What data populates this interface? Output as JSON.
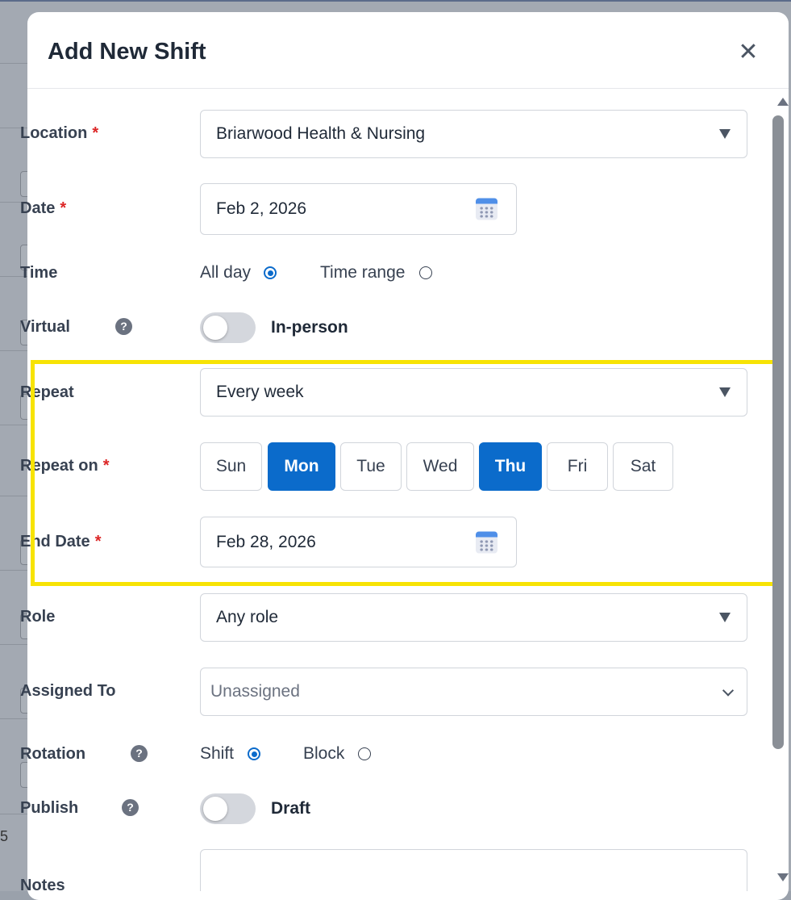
{
  "modal": {
    "title": "Add New Shift",
    "close_icon": "close-icon"
  },
  "location": {
    "label": "Location",
    "required": "*",
    "value": "Briarwood Health & Nursing"
  },
  "date": {
    "label": "Date",
    "required": "*",
    "value": "Feb 2, 2026"
  },
  "time": {
    "label": "Time",
    "options": [
      {
        "label": "All day",
        "selected": true
      },
      {
        "label": "Time range",
        "selected": false
      }
    ]
  },
  "virtual": {
    "label": "Virtual",
    "help": "?",
    "toggle_on": false,
    "state_label": "In-person"
  },
  "repeat": {
    "label": "Repeat",
    "value": "Every week"
  },
  "repeat_on": {
    "label": "Repeat on",
    "required": "*",
    "days": [
      {
        "label": "Sun",
        "selected": false
      },
      {
        "label": "Mon",
        "selected": true
      },
      {
        "label": "Tue",
        "selected": false
      },
      {
        "label": "Wed",
        "selected": false
      },
      {
        "label": "Thu",
        "selected": true
      },
      {
        "label": "Fri",
        "selected": false
      },
      {
        "label": "Sat",
        "selected": false
      }
    ]
  },
  "end_date": {
    "label": "End Date",
    "required": "*",
    "value": "Feb 28, 2026"
  },
  "role": {
    "label": "Role",
    "value": "Any role"
  },
  "assigned_to": {
    "label": "Assigned To",
    "placeholder": "Unassigned"
  },
  "rotation": {
    "label": "Rotation",
    "help": "?",
    "options": [
      {
        "label": "Shift",
        "selected": true
      },
      {
        "label": "Block",
        "selected": false
      }
    ]
  },
  "publish": {
    "label": "Publish",
    "help": "?",
    "toggle_on": false,
    "state_label": "Draft"
  },
  "notes": {
    "label": "Notes",
    "value": ""
  },
  "background": {
    "page_number": "5"
  },
  "colors": {
    "accent": "#0b6bcb",
    "required": "#dc2626",
    "highlight": "#f7e304"
  }
}
